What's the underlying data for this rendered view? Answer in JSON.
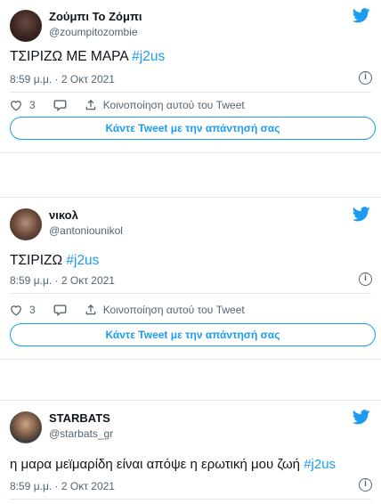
{
  "tweets": [
    {
      "display_name": "Ζούμπι Το Ζόμπι",
      "handle": "@zoumpitozombie",
      "text": "ΤΣΙΡΙΖΩ ΜΕ ΜΑΡΑ ",
      "hashtag": "#j2us",
      "timestamp": "8:59 μ.μ. · 2 Οκτ 2021",
      "likes": "3",
      "share_label": "Κοινοποίηση αυτού του Tweet",
      "reply_label": "Κάντε Tweet με την απάντησή σας"
    },
    {
      "display_name": "νικολ",
      "handle": "@antoniounikol",
      "text": "ΤΣΙΡΙΖΩ ",
      "hashtag": "#j2us",
      "timestamp": "8:59 μ.μ. · 2 Οκτ 2021",
      "likes": "3",
      "share_label": "Κοινοποίηση αυτού του Tweet",
      "reply_label": "Κάντε Tweet με την απάντησή σας"
    },
    {
      "display_name": "STARBATS",
      "handle": "@starbats_gr",
      "text": "η μαρα μεϊμαρίδη είναι απόψε η ερωτική μου ζωή ",
      "hashtag": "#j2us",
      "timestamp": "8:59 μ.μ. · 2 Οκτ 2021"
    }
  ],
  "icons": {
    "brand": "twitter-bird-icon",
    "like": "heart-icon",
    "reply": "speech-bubble-icon",
    "share": "share-upload-icon",
    "info": "info-icon"
  },
  "colors": {
    "accent": "#1d9bf0",
    "text": "#0f1419",
    "muted": "#536471",
    "border": "#e1e8ed"
  }
}
